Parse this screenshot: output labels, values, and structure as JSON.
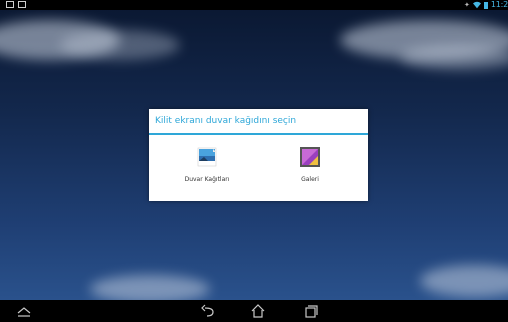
{
  "status_bar": {
    "time": "11:2",
    "left_icons": [
      "notification-icon",
      "screenshot-icon"
    ],
    "right_icons": [
      "signal-icon",
      "wifi-icon",
      "battery-icon"
    ],
    "accent_color": "#45b7e3"
  },
  "wallpaper": {
    "description_colors": [
      "#0a1730",
      "#2d5793"
    ]
  },
  "dialog": {
    "title": "Kilit ekranı duvar kağıdını seçin",
    "title_color": "#2ea7d8",
    "options": [
      {
        "label": "Duvar Kağıtları",
        "icon": "wallpapers-icon"
      },
      {
        "label": "Galeri",
        "icon": "gallery-icon"
      }
    ]
  },
  "nav_bar": {
    "buttons": [
      "up-icon",
      "back-icon",
      "home-icon",
      "recent-apps-icon"
    ]
  }
}
